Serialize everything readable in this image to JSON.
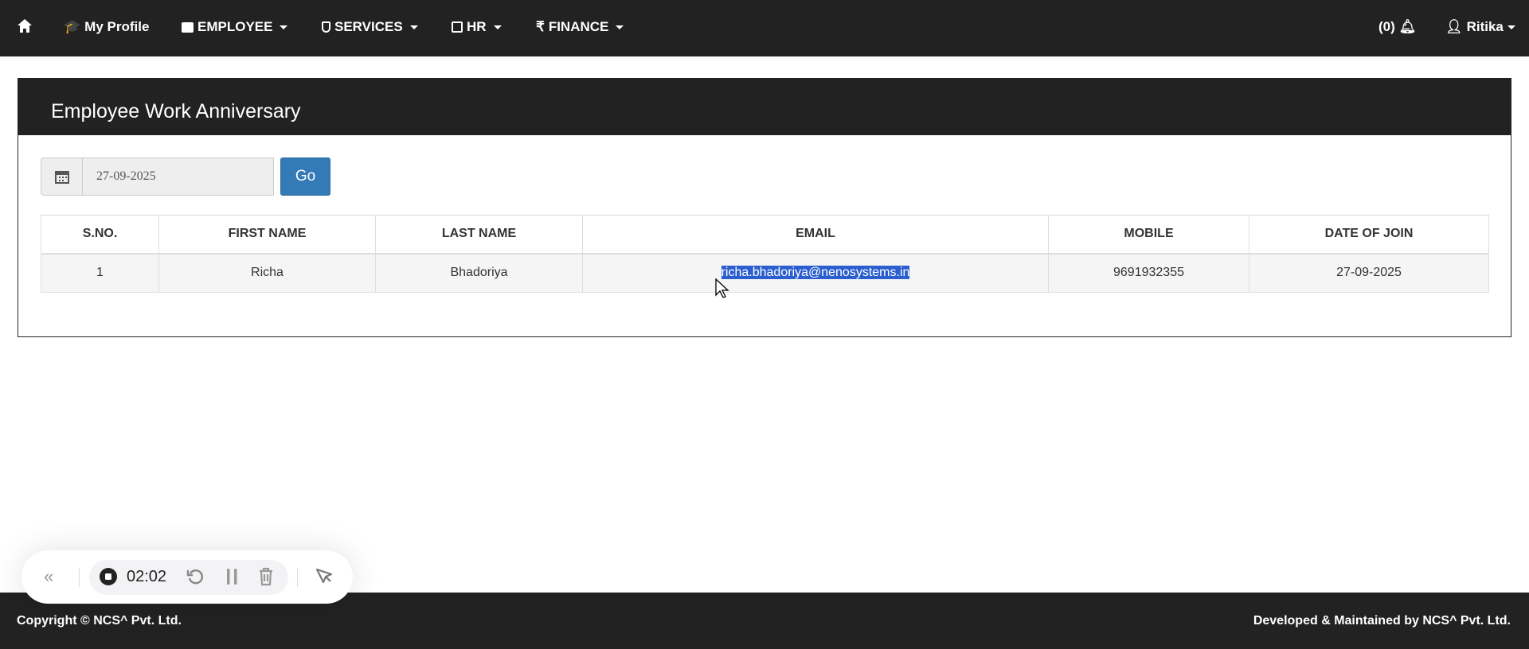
{
  "nav": {
    "my_profile": "My Profile",
    "employee": "EMPLOYEE",
    "services": "SERVICES",
    "hr": "HR",
    "finance": "FINANCE",
    "notifications": "(0)",
    "user": "Ritika"
  },
  "panel": {
    "title": "Employee Work Anniversary",
    "date_value": "27-09-2025",
    "go_label": "Go"
  },
  "table": {
    "headers": [
      "S.NO.",
      "FIRST NAME",
      "LAST NAME",
      "EMAIL",
      "MOBILE",
      "DATE OF JOIN"
    ],
    "rows": [
      [
        "1",
        "Richa",
        "Bhadoriya",
        "richa.bhadoriya@nenosystems.in",
        "9691932355",
        "27-09-2025"
      ]
    ]
  },
  "footer": {
    "left": "Copyright © NCS^ Pvt. Ltd.",
    "right": "Developed & Maintained by NCS^ Pvt. Ltd."
  },
  "recorder": {
    "time": "02:02"
  }
}
